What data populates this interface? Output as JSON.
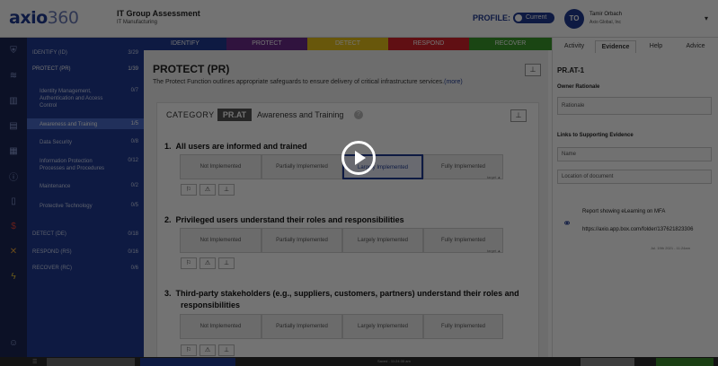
{
  "header": {
    "logo": "axio",
    "logo_num": "360",
    "assessment_title": "IT Group Assessment",
    "assessment_sub": "IT  Manufacturing",
    "profile_label": "PROFILE:",
    "profile_toggle": "Current",
    "avatar_initials": "TO",
    "user_name": "Tamir Orbach",
    "user_org": "Axio Global, Inc"
  },
  "sidebar": {
    "items": [
      {
        "label": "IDENTIFY (ID)",
        "count": "3/29"
      },
      {
        "label": "PROTECT (PR)",
        "count": "1/39"
      },
      {
        "label": "Identity Management, Authentication and Access Control",
        "count": "0/7"
      },
      {
        "label": "Awareness and Training",
        "count": "1/5"
      },
      {
        "label": "Data Security",
        "count": "0/8"
      },
      {
        "label": "Information Protection Processes and Procedures",
        "count": "0/12"
      },
      {
        "label": "Maintenance",
        "count": "0/2"
      },
      {
        "label": "Protective Technology",
        "count": "0/5"
      },
      {
        "label": "DETECT (DE)",
        "count": "0/18"
      },
      {
        "label": "RESPOND (RS)",
        "count": "0/16"
      },
      {
        "label": "RECOVER (RC)",
        "count": "0/6"
      }
    ]
  },
  "function_tabs": [
    {
      "label": "IDENTIFY",
      "color": "#1f3a93"
    },
    {
      "label": "PROTECT",
      "color": "#6a2c8a"
    },
    {
      "label": "DETECT",
      "color": "#e6c21a"
    },
    {
      "label": "RESPOND",
      "color": "#d4232a"
    },
    {
      "label": "RECOVER",
      "color": "#3a9a2a"
    }
  ],
  "main": {
    "title": "PROTECT (PR)",
    "description": "The Protect Function outlines appropriate safeguards to ensure delivery of critical infrastructure services.",
    "more": "(more)",
    "category_label": "CATEGORY",
    "category_code": "PR.AT",
    "category_name": "Awareness and Training",
    "options": [
      "Not Implemented",
      "Partially Implemented",
      "Largely Implemented",
      "Fully Implemented"
    ],
    "questions": [
      {
        "num": "1.",
        "text": "All users are informed and trained"
      },
      {
        "num": "2.",
        "text": "Privileged users understand their roles and responsibilities"
      },
      {
        "num": "3.",
        "text": "Third-party stakeholders (e.g., suppliers, customers, partners) understand their roles and"
      },
      {
        "num": "",
        "text": "responsibilities"
      }
    ],
    "mini_label": "target ▲"
  },
  "right_panel": {
    "tabs": [
      "Activity",
      "Evidence",
      "Help",
      "Advice"
    ],
    "title": "PR.AT-1",
    "owner_label": "Owner Rationale",
    "rationale_placeholder": "Rationale",
    "links_label": "Links to Supporting Evidence",
    "name_placeholder": "Name",
    "location_placeholder": "Location of document",
    "evidence_title": "Report showing eLearning on MFA",
    "evidence_url": "https://axio.app.box.com/folder/137621823306",
    "evidence_date": "Jul. 19th 2021 - 11:24am"
  },
  "footer": {
    "saved": "Saved - 11:24:35 am"
  },
  "colors": {
    "primary": "#1f3a93",
    "sidebar_bg": "#1f3a93",
    "rail_bg": "#1b2656"
  }
}
